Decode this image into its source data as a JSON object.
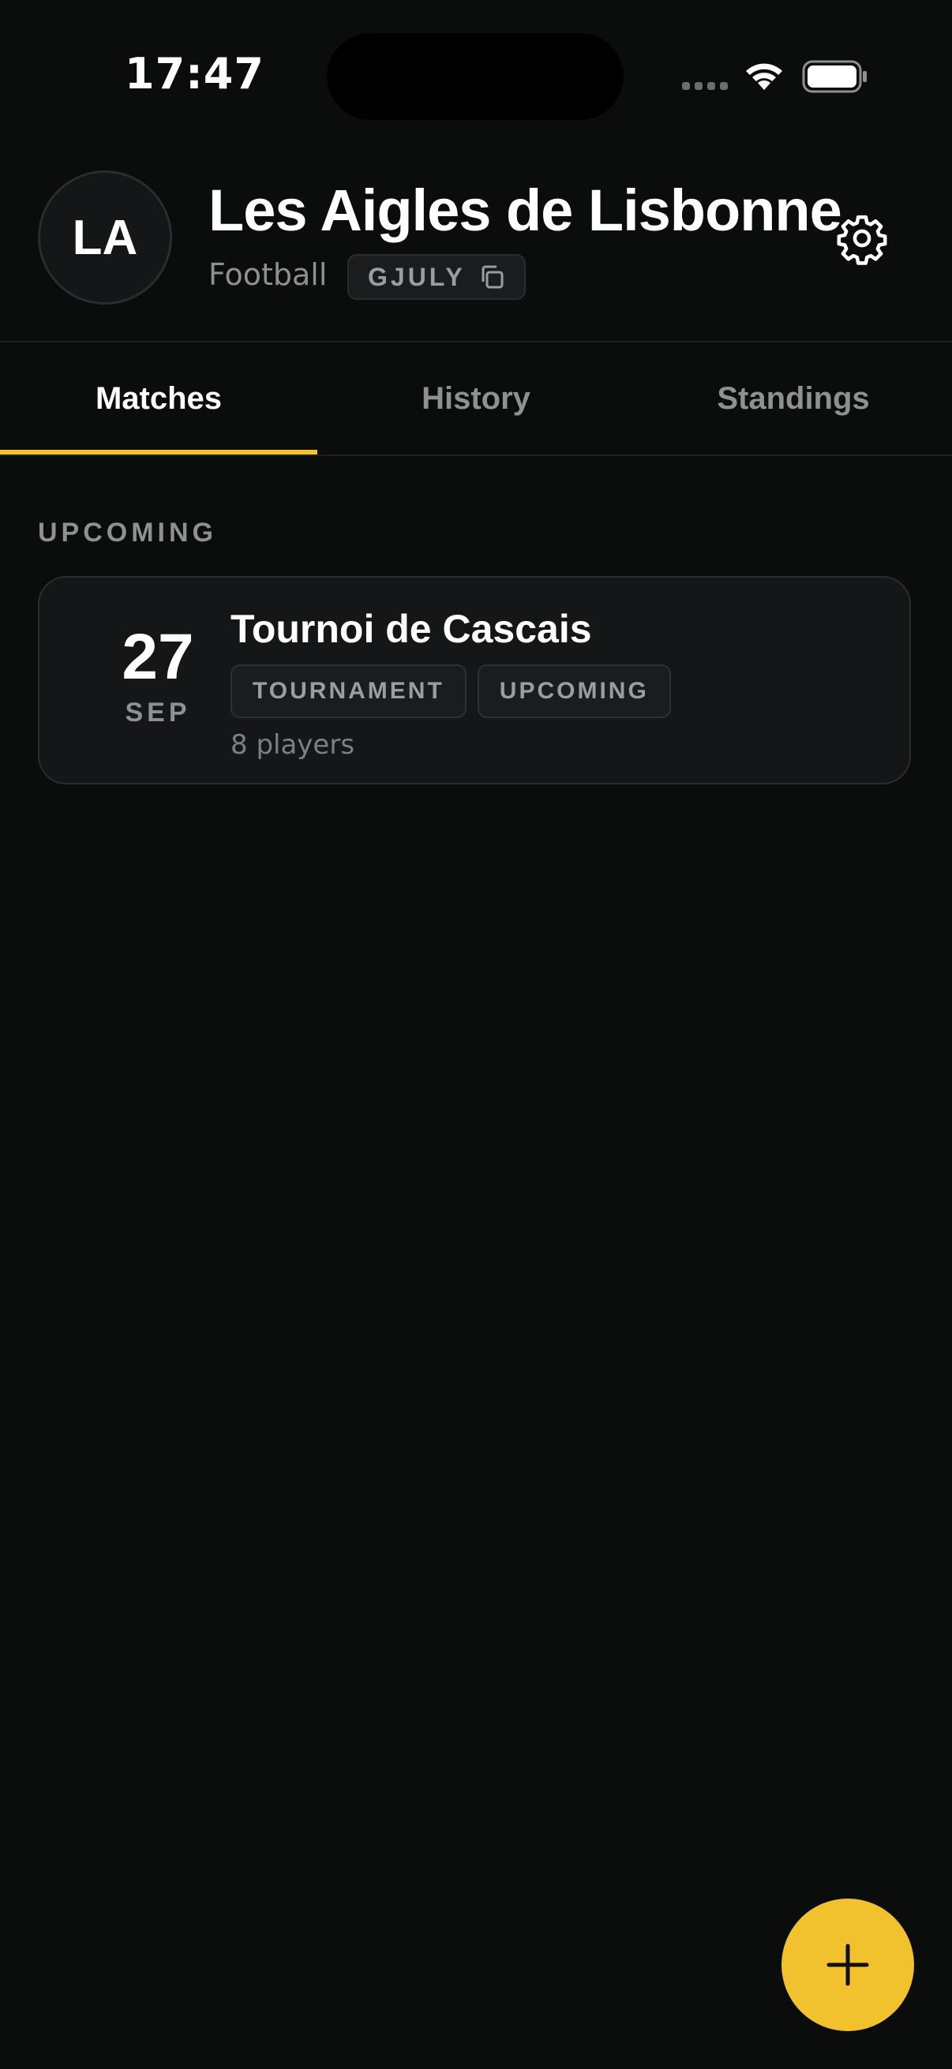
{
  "status_bar": {
    "time": "17:47"
  },
  "header": {
    "avatar_initials": "LA",
    "team_name": "Les Aigles de Lisbonne",
    "sport": "Football",
    "invite_code": "GJULY",
    "icons": {
      "copy": "copy-icon",
      "settings": "gear-icon"
    }
  },
  "tabs": [
    {
      "label": "Matches",
      "active": true
    },
    {
      "label": "History",
      "active": false
    },
    {
      "label": "Standings",
      "active": false
    }
  ],
  "upcoming": {
    "section_label": "UPCOMING",
    "matches": [
      {
        "day": "27",
        "month": "SEP",
        "title": "Tournoi de Cascais",
        "badges": [
          "TOURNAMENT",
          "UPCOMING"
        ],
        "players": "8 players"
      }
    ]
  },
  "fab": {
    "icon": "plus-icon"
  },
  "colors": {
    "background": "#0b0c0c",
    "accent": "#f2c12e",
    "card": "#141617",
    "muted_text": "#8d9192"
  }
}
